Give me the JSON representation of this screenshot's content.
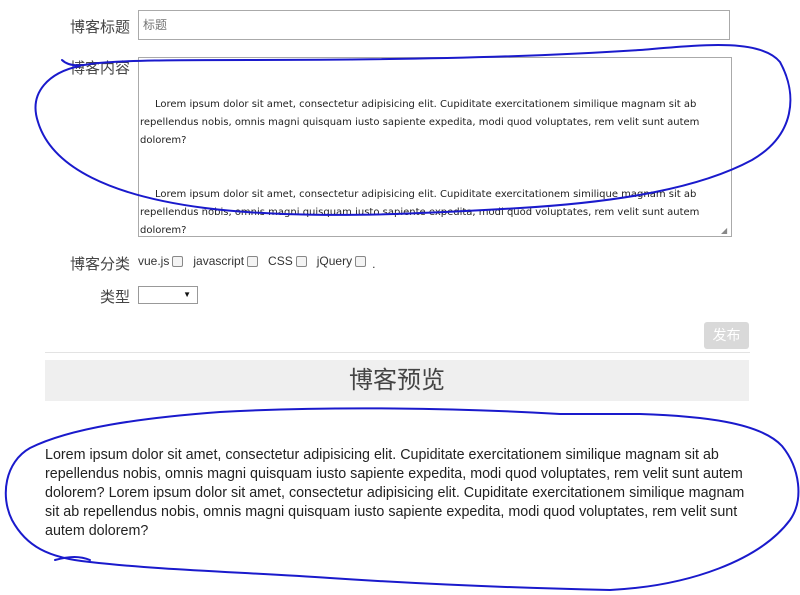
{
  "form": {
    "title_label": "博客标题",
    "title_placeholder": "标题",
    "content_label": "博客内容",
    "content_paragraphs": [
      "Lorem ipsum dolor sit amet, consectetur adipisicing elit. Cupiditate exercitationem similique magnam sit ab repellendus nobis, omnis magni quisquam iusto sapiente expedita, modi quod voluptates, rem velit sunt autem dolorem?",
      "Lorem ipsum dolor sit amet, consectetur adipisicing elit. Cupiditate exercitationem similique magnam sit ab repellendus nobis, omnis magni quisquam iusto sapiente expedita, modi quod voluptates, rem velit sunt autem dolorem?"
    ],
    "category_label": "博客分类",
    "categories": [
      {
        "label": "vue.js",
        "checked": false
      },
      {
        "label": "javascript",
        "checked": false
      },
      {
        "label": "CSS",
        "checked": false
      },
      {
        "label": "jQuery",
        "checked": false
      }
    ],
    "category_trailing": ".",
    "type_label": "类型",
    "type_selected": "",
    "publish_label": "发布"
  },
  "preview": {
    "heading": "博客预览",
    "body": "Lorem ipsum dolor sit amet, consectetur adipisicing elit. Cupiditate exercitationem similique magnam sit ab repellendus nobis, omnis magni quisquam iusto sapiente expedita, modi quod voluptates, rem velit sunt autem dolorem? Lorem ipsum dolor sit amet, consectetur adipisicing elit. Cupiditate exercitationem similique magnam sit ab repellendus nobis, omnis magni quisquam iusto sapiente expedita, modi quod voluptates, rem velit sunt autem dolorem?"
  },
  "colors": {
    "annotation_ink": "#1a1acc",
    "publish_bg": "#d9d9d9",
    "preview_header_bg": "#efefef"
  }
}
